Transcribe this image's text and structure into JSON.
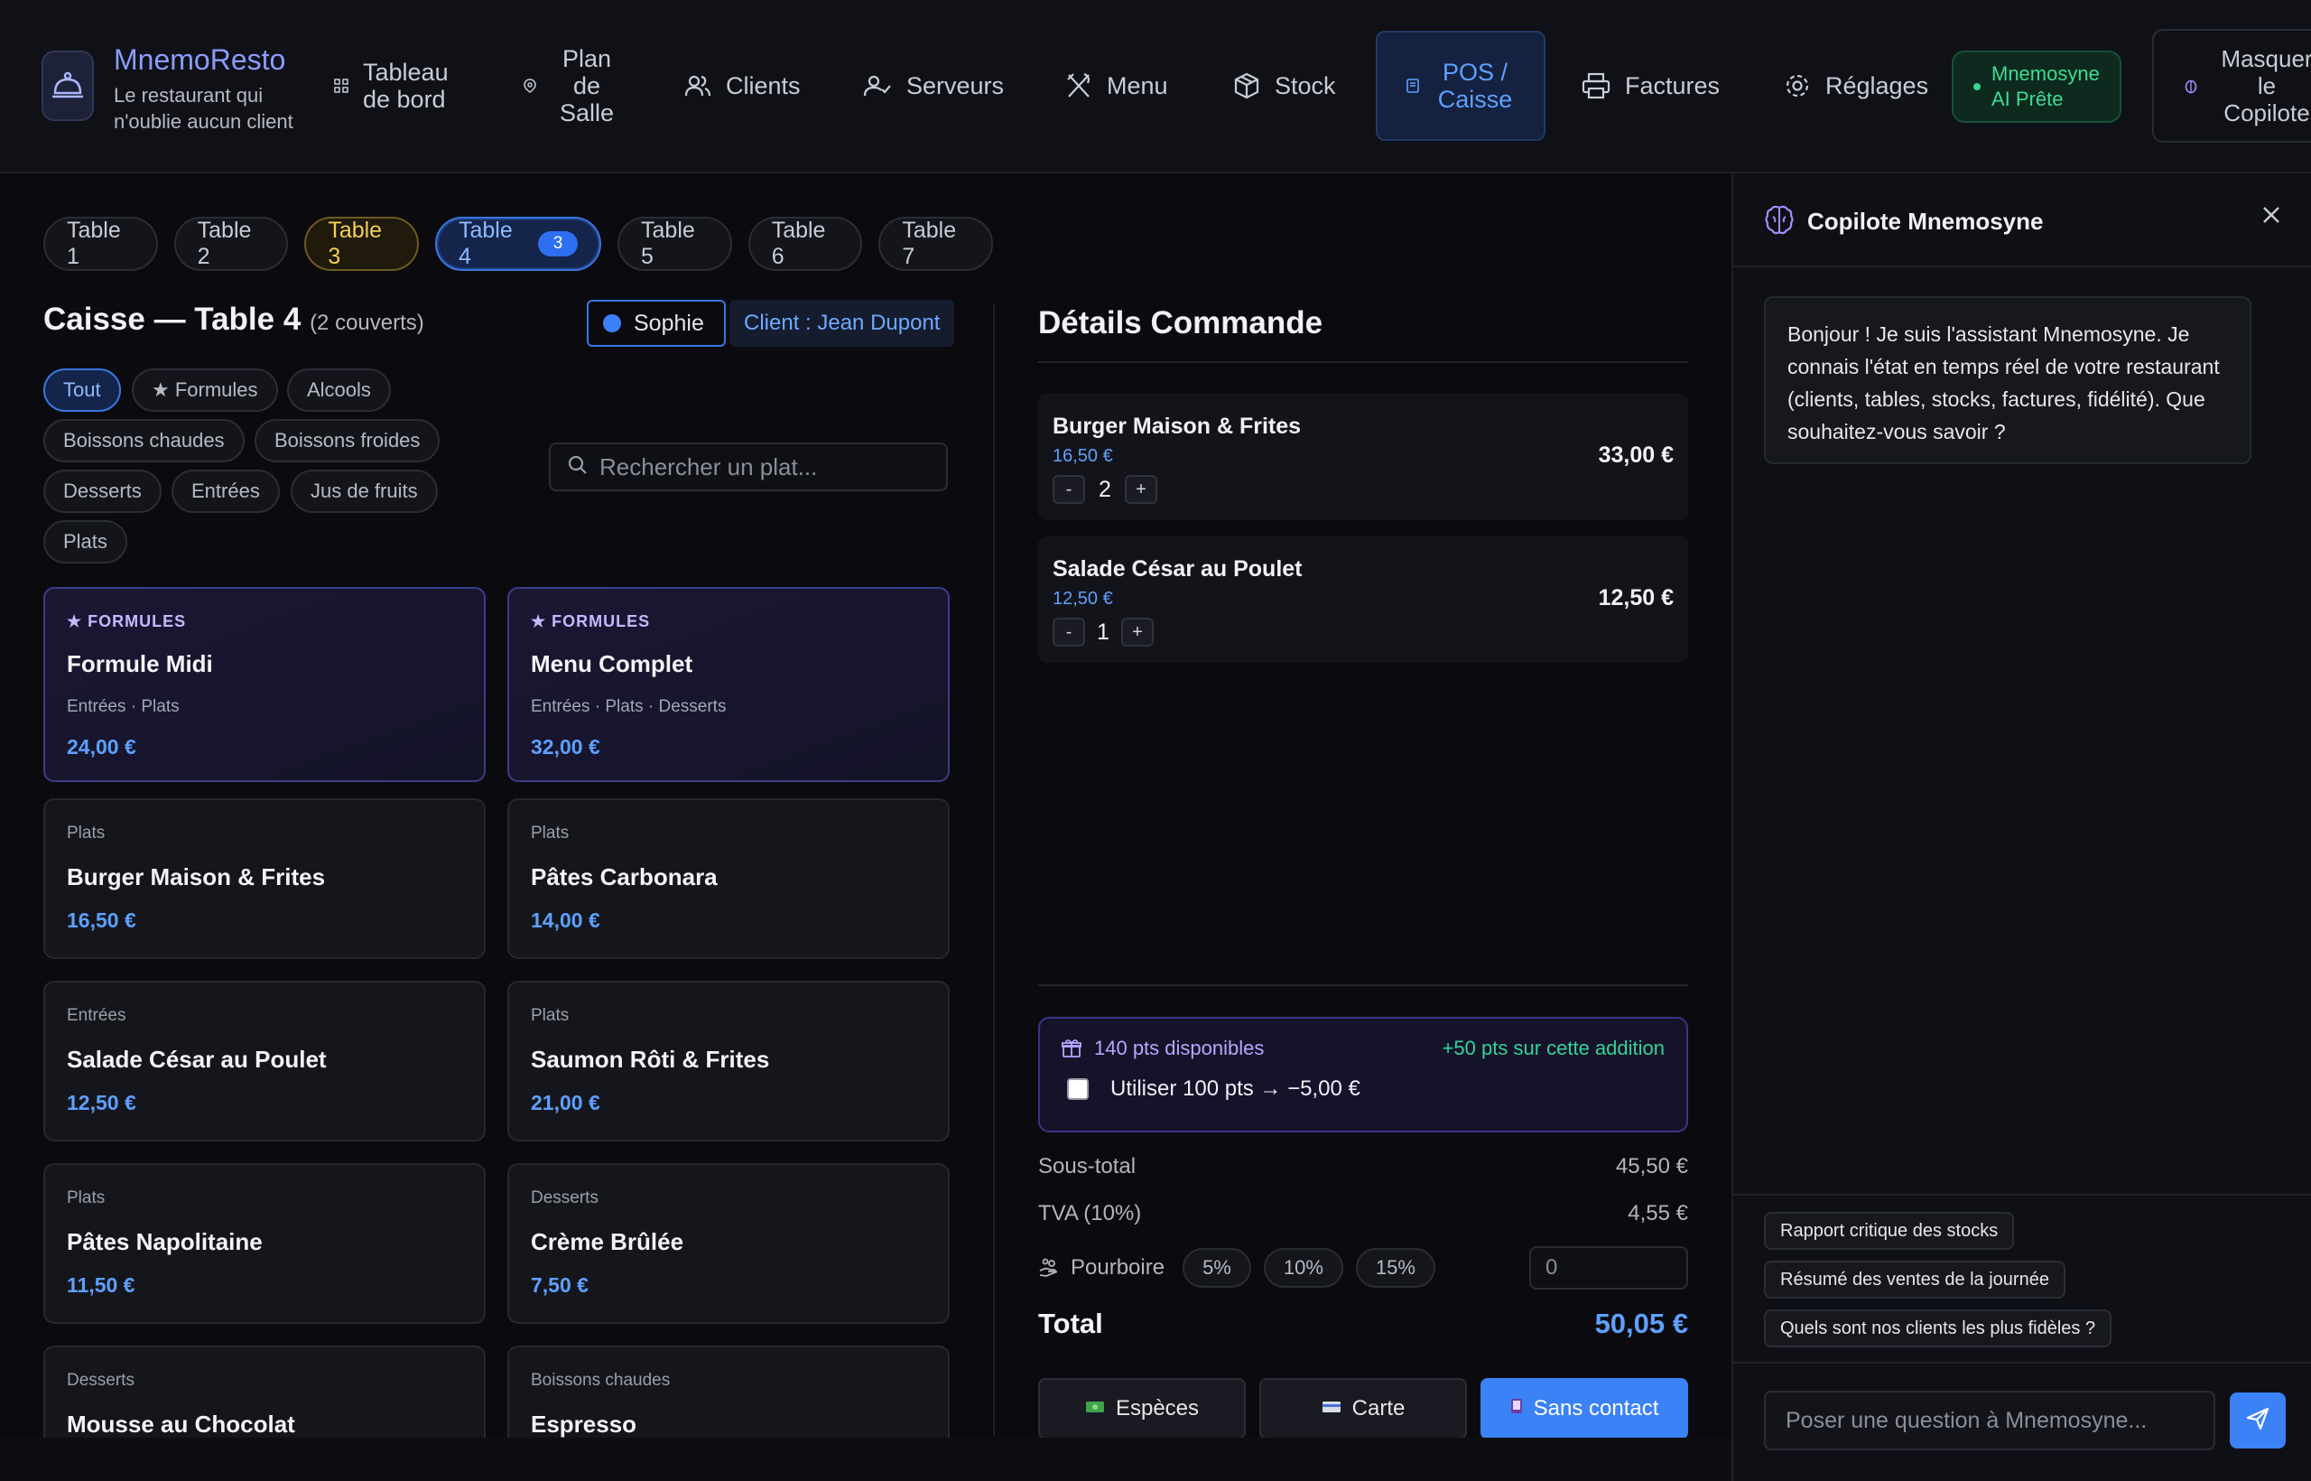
{
  "brand": {
    "name": "MnemoResto",
    "tagline": "Le restaurant qui n'oublie aucun client"
  },
  "nav": {
    "dashboard": "Tableau de bord",
    "floor_plan": "Plan de Salle",
    "clients": "Clients",
    "servers": "Serveurs",
    "menu": "Menu",
    "stock": "Stock",
    "pos": "POS / Caisse",
    "invoices": "Factures",
    "settings": "Réglages",
    "ai_status": "Mnemosyne AI Prête",
    "hide_copilot": "Masquer le Copilote"
  },
  "tables": [
    {
      "label": "Table 1"
    },
    {
      "label": "Table 2"
    },
    {
      "label": "Table 3"
    },
    {
      "label": "Table 4",
      "count": "3"
    },
    {
      "label": "Table 5"
    },
    {
      "label": "Table 6"
    },
    {
      "label": "Table 7"
    }
  ],
  "caisse": {
    "title": "Caisse — Table 4",
    "covers": "(2 couverts)",
    "server": "Sophie",
    "client": "Client : Jean Dupont"
  },
  "categories": [
    "Tout",
    "★ Formules",
    "Alcools",
    "Boissons chaudes",
    "Boissons froides",
    "Desserts",
    "Entrées",
    "Jus de fruits",
    "Plats"
  ],
  "search": {
    "placeholder": "Rechercher un plat..."
  },
  "products": [
    {
      "category": "★ FORMULES",
      "name": "Formule Midi",
      "desc": "Entrées · Plats",
      "price": "24,00 €"
    },
    {
      "category": "★ FORMULES",
      "name": "Menu Complet",
      "desc": "Entrées · Plats · Desserts",
      "price": "32,00 €"
    },
    {
      "category": "Plats",
      "name": "Burger Maison & Frites",
      "price": "16,50 €"
    },
    {
      "category": "Plats",
      "name": "Pâtes Carbonara",
      "price": "14,00 €"
    },
    {
      "category": "Entrées",
      "name": "Salade César au Poulet",
      "price": "12,50 €"
    },
    {
      "category": "Plats",
      "name": "Saumon Rôti & Frites",
      "price": "21,00 €"
    },
    {
      "category": "Plats",
      "name": "Pâtes Napolitaine",
      "price": "11,50 €"
    },
    {
      "category": "Desserts",
      "name": "Crème Brûlée",
      "price": "7,50 €"
    },
    {
      "category": "Desserts",
      "name": "Mousse au Chocolat",
      "price": ""
    },
    {
      "category": "Boissons chaudes",
      "name": "Espresso",
      "price": ""
    }
  ],
  "order": {
    "title": "Détails Commande",
    "items": [
      {
        "name": "Burger Maison & Frites",
        "unit_price": "16,50 €",
        "qty": "2",
        "total": "33,00 €"
      },
      {
        "name": "Salade César au Poulet",
        "unit_price": "12,50 €",
        "qty": "1",
        "total": "12,50 €"
      }
    ],
    "loyalty": {
      "available": "140 pts disponibles",
      "earned": "+50 pts sur cette addition",
      "use_label": "Utiliser 100 pts → −5,00 €"
    },
    "subtotal_label": "Sous-total",
    "subtotal": "45,50 €",
    "tax_label": "TVA (10%)",
    "tax": "4,55 €",
    "tip_label": "Pourboire",
    "tip_options": [
      "5%",
      "10%",
      "15%"
    ],
    "tip_value": "0",
    "total_label": "Total",
    "total": "50,05 €",
    "pay_cash": "Espèces",
    "pay_card": "Carte",
    "pay_contactless": "Sans contact"
  },
  "copilot": {
    "title": "Copilote Mnemosyne",
    "greeting": "Bonjour ! Je suis l'assistant Mnemosyne. Je connais l'état en temps réel de votre restaurant (clients, tables, stocks, factures, fidélité). Que souhaitez-vous savoir ?",
    "suggestions": [
      "Rapport critique des stocks",
      "Résumé des ventes de la journée",
      "Quels sont nos clients les plus fidèles ?"
    ],
    "input_placeholder": "Poser une question à Mnemosyne..."
  },
  "colors": {
    "accent": "#3b82f6",
    "brand": "#8b9cff",
    "success": "#34d399",
    "warning": "#f2cf55"
  }
}
